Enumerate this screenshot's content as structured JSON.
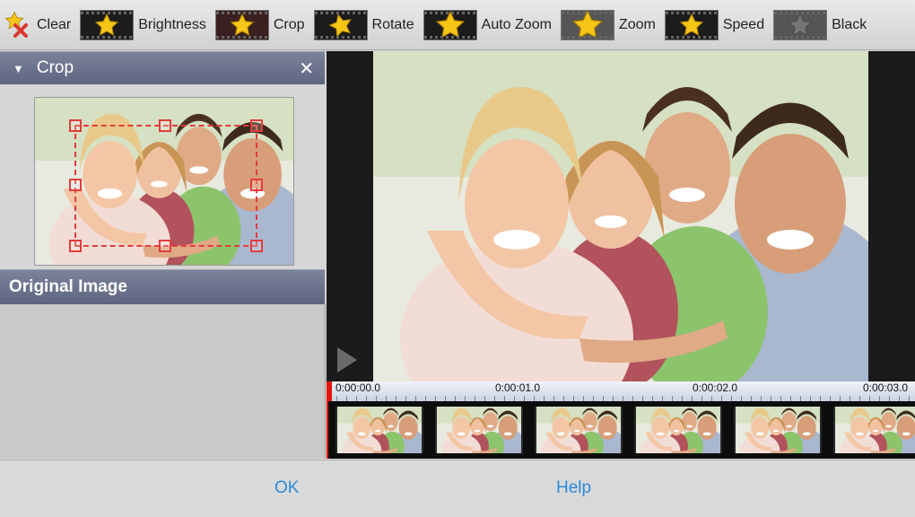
{
  "toolbar": {
    "items": [
      {
        "label": "Clear",
        "icon": "clear-star-icon"
      },
      {
        "label": "Brightness",
        "icon": "brightness-star-icon"
      },
      {
        "label": "Crop",
        "icon": "crop-star-icon"
      },
      {
        "label": "Rotate",
        "icon": "rotate-star-icon"
      },
      {
        "label": "Auto Zoom",
        "icon": "auto-zoom-star-icon"
      },
      {
        "label": "Zoom",
        "icon": "zoom-star-icon"
      },
      {
        "label": "Speed",
        "icon": "speed-star-icon"
      },
      {
        "label": "Black",
        "icon": "black-star-icon"
      }
    ]
  },
  "crop_panel": {
    "title": "Crop",
    "close_icon": "close-icon",
    "collapse_icon": "triangle-down-icon"
  },
  "original_panel": {
    "title": "Original Image"
  },
  "timeline": {
    "ticks": [
      "0:00:00.0",
      "0:00:01.0",
      "0:00:02.0",
      "0:00:03.0"
    ]
  },
  "footer": {
    "ok_label": "OK",
    "help_label": "Help"
  },
  "colors": {
    "accent": "#2c8bd8",
    "playhead": "#e3170f",
    "crop_frame": "#e23c3c",
    "panel_header": "#6a728b",
    "star": "#f5c518"
  }
}
